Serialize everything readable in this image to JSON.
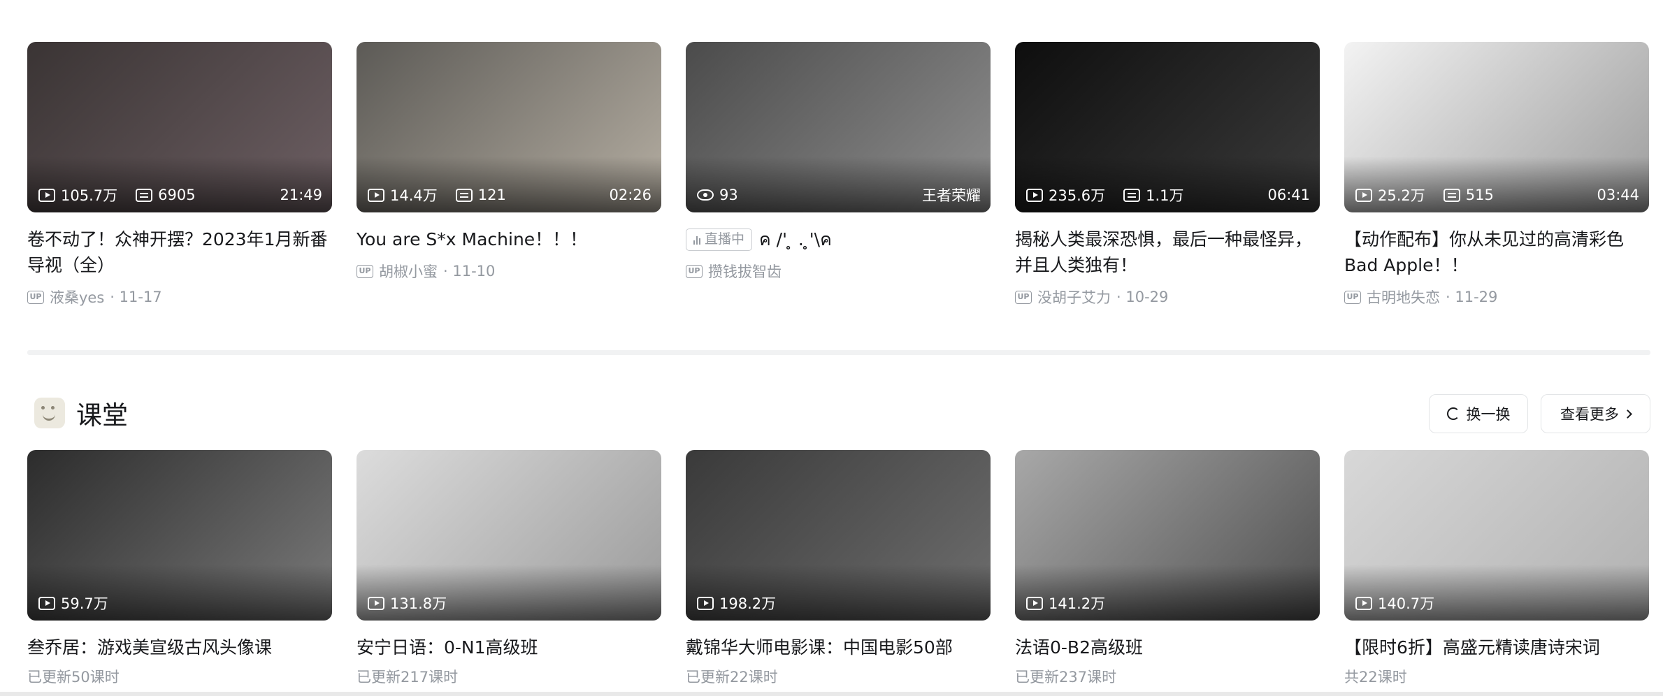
{
  "videos": [
    {
      "thumb_colors": [
        "#3a3434",
        "#6d5f63"
      ],
      "stats": [
        {
          "icon": "play-icon",
          "value": "105.7万"
        },
        {
          "icon": "danmaku-icon",
          "value": "6905"
        }
      ],
      "duration": "21:49",
      "title": "卷不动了！众神开摆？2023年1月新番导视（全）",
      "uploader": "液桑yes",
      "date": "· 11-17"
    },
    {
      "thumb_colors": [
        "#5c5a56",
        "#b5aea2"
      ],
      "stats": [
        {
          "icon": "play-icon",
          "value": "14.4万"
        },
        {
          "icon": "danmaku-icon",
          "value": "121"
        }
      ],
      "duration": "02:26",
      "title": "You are S*x Machine！！！",
      "uploader": "胡椒小蜜",
      "date": "· 11-10"
    },
    {
      "thumb_colors": [
        "#4b4b4b",
        "#8f8f8f"
      ],
      "stats": [
        {
          "icon": "eye-icon",
          "value": "93"
        }
      ],
      "tag": "王者荣耀",
      "live": "直播中",
      "title": "ค /' ̥ . ̥'\\ค",
      "uploader": "攒钱拔智齿",
      "date": ""
    },
    {
      "thumb_colors": [
        "#0e0e0e",
        "#3b3b3b"
      ],
      "stats": [
        {
          "icon": "play-icon",
          "value": "235.6万"
        },
        {
          "icon": "danmaku-icon",
          "value": "1.1万"
        }
      ],
      "duration": "06:41",
      "title": "揭秘人类最深恐惧，最后一种最怪异，并且人类独有！",
      "uploader": "没胡子艾力",
      "date": "· 10-29"
    },
    {
      "thumb_colors": [
        "#f3f3f3",
        "#9c9c9c"
      ],
      "stats": [
        {
          "icon": "play-icon",
          "value": "25.2万"
        },
        {
          "icon": "danmaku-icon",
          "value": "515"
        }
      ],
      "duration": "03:44",
      "title": "【动作配布】你从未见过的高清彩色Bad Apple！！",
      "uploader": "古明地失恋",
      "date": "· 11-29"
    }
  ],
  "section": {
    "title": "课堂",
    "change_label": "换一换",
    "more_label": "查看更多"
  },
  "courses": [
    {
      "thumb_colors": [
        "#2c2c2c",
        "#7a7a7a"
      ],
      "plays": "59.7万",
      "title": "叁乔居：游戏美宣级古风头像课",
      "sub": "已更新50课时"
    },
    {
      "thumb_colors": [
        "#dcdcdc",
        "#9a9a9a"
      ],
      "plays": "131.8万",
      "title": "安宁日语：0-N1高级班",
      "sub": "已更新217课时"
    },
    {
      "thumb_colors": [
        "#3a3a3a",
        "#6e6e6e"
      ],
      "plays": "198.2万",
      "title": "戴锦华大师电影课：中国电影50部",
      "sub": "已更新22课时"
    },
    {
      "thumb_colors": [
        "#a8a8a8",
        "#4f4f4f"
      ],
      "plays": "141.2万",
      "title": "法语0-B2高级班",
      "sub": "已更新237课时"
    },
    {
      "thumb_colors": [
        "#d8d8d8",
        "#b0b0b0"
      ],
      "plays": "140.7万",
      "title": "【限时6折】高盛元精读唐诗宋词",
      "sub": "共22课时"
    }
  ]
}
